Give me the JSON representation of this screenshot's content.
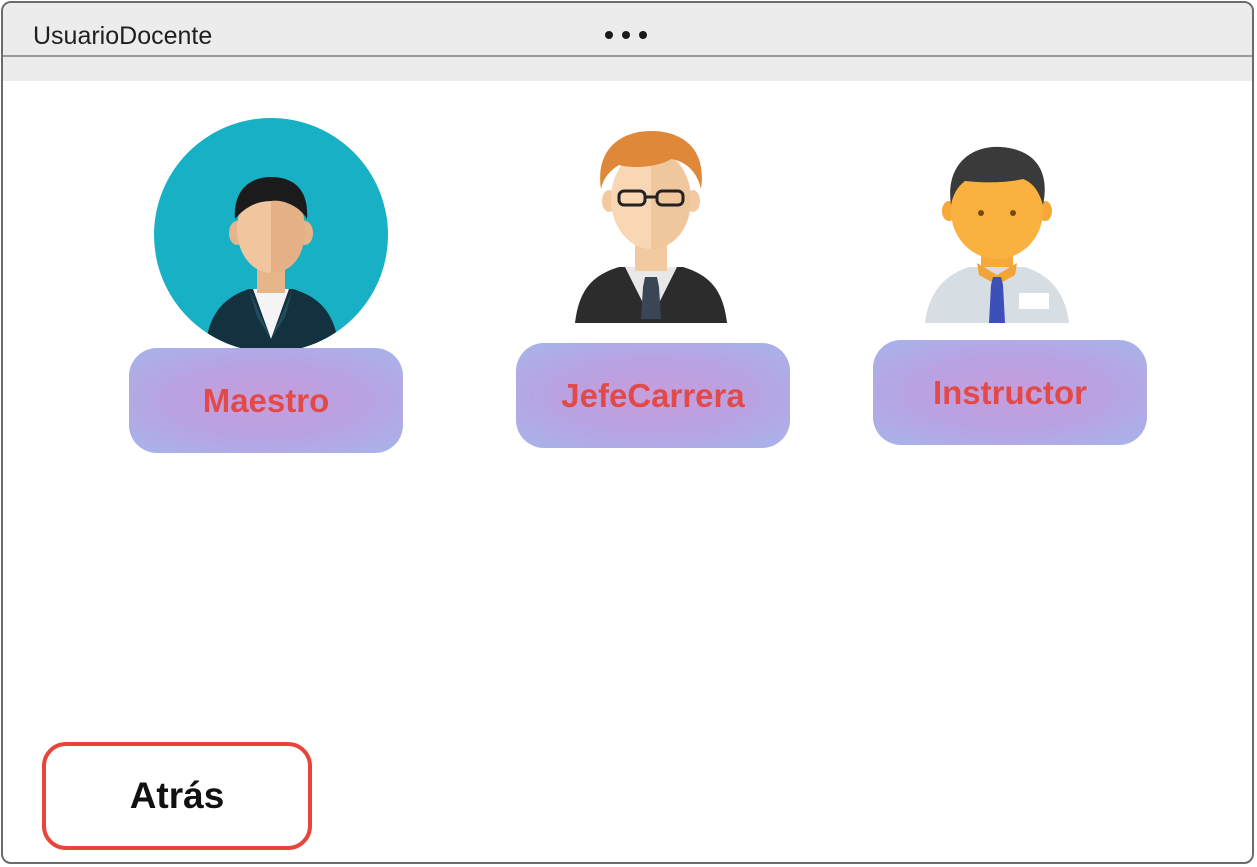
{
  "window": {
    "title": "UsuarioDocente",
    "menu_icon": "more-horizontal-icon"
  },
  "roles": [
    {
      "label": "Maestro",
      "icon": "teacher-avatar-icon"
    },
    {
      "label": "JefeCarrera",
      "icon": "department-head-avatar-icon"
    },
    {
      "label": "Instructor",
      "icon": "instructor-avatar-icon"
    }
  ],
  "back_button": {
    "label": "Atrás"
  },
  "colors": {
    "role_label": "#e24a4a",
    "back_border": "#e8443c",
    "avatar_circle": "#17b0c4"
  }
}
